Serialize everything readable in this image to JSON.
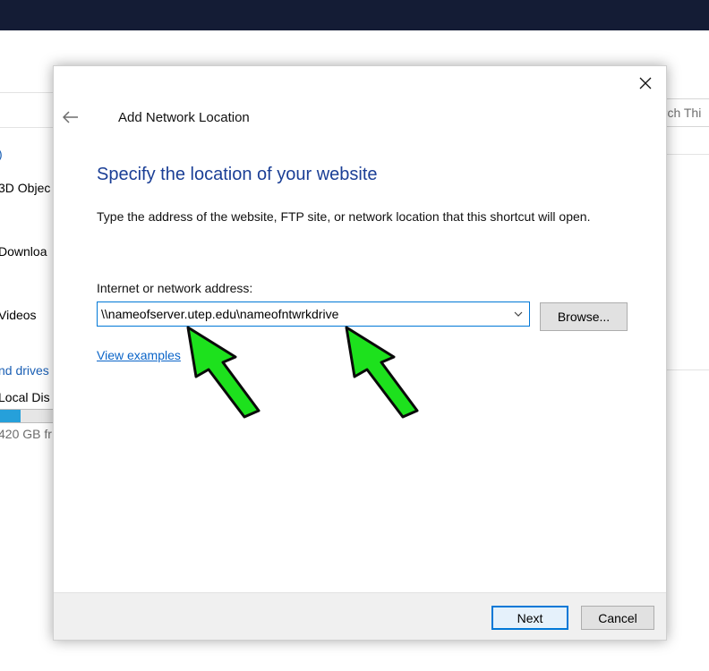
{
  "background_window": {
    "search_placeholder_fragment": "arch Thi",
    "nav_items": [
      {
        "label": ")",
        "kind": "link"
      },
      {
        "label": "3D Objec",
        "kind": "folder"
      },
      {
        "label": "Downloa",
        "kind": "folder"
      },
      {
        "label": "Videos",
        "kind": "folder"
      },
      {
        "label": "nd drives",
        "kind": "link"
      },
      {
        "label": "Local Dis",
        "kind": "drive"
      }
    ],
    "drive_free_text": "420 GB fr",
    "drive_usage_fraction": 0.4
  },
  "dialog": {
    "title": "Add Network Location",
    "heading": "Specify the location of your website",
    "description": "Type the address of the website, FTP site, or network location that this shortcut will open.",
    "address_label": "Internet or network address:",
    "address_value": "\\\\nameofserver.utep.edu\\nameofntwrkdrive",
    "browse_label": "Browse...",
    "examples_link": "View examples",
    "next_label": "Next",
    "cancel_label": "Cancel"
  },
  "colors": {
    "heading": "#1b3f96",
    "accent": "#0078d7",
    "link": "#0a64c8",
    "annotation_arrow": "#1de11d"
  },
  "icons": {
    "close": "close-icon",
    "back": "back-arrow-icon",
    "dropdown": "chevron-down-icon",
    "annotation": "annotation-arrow-icon"
  }
}
